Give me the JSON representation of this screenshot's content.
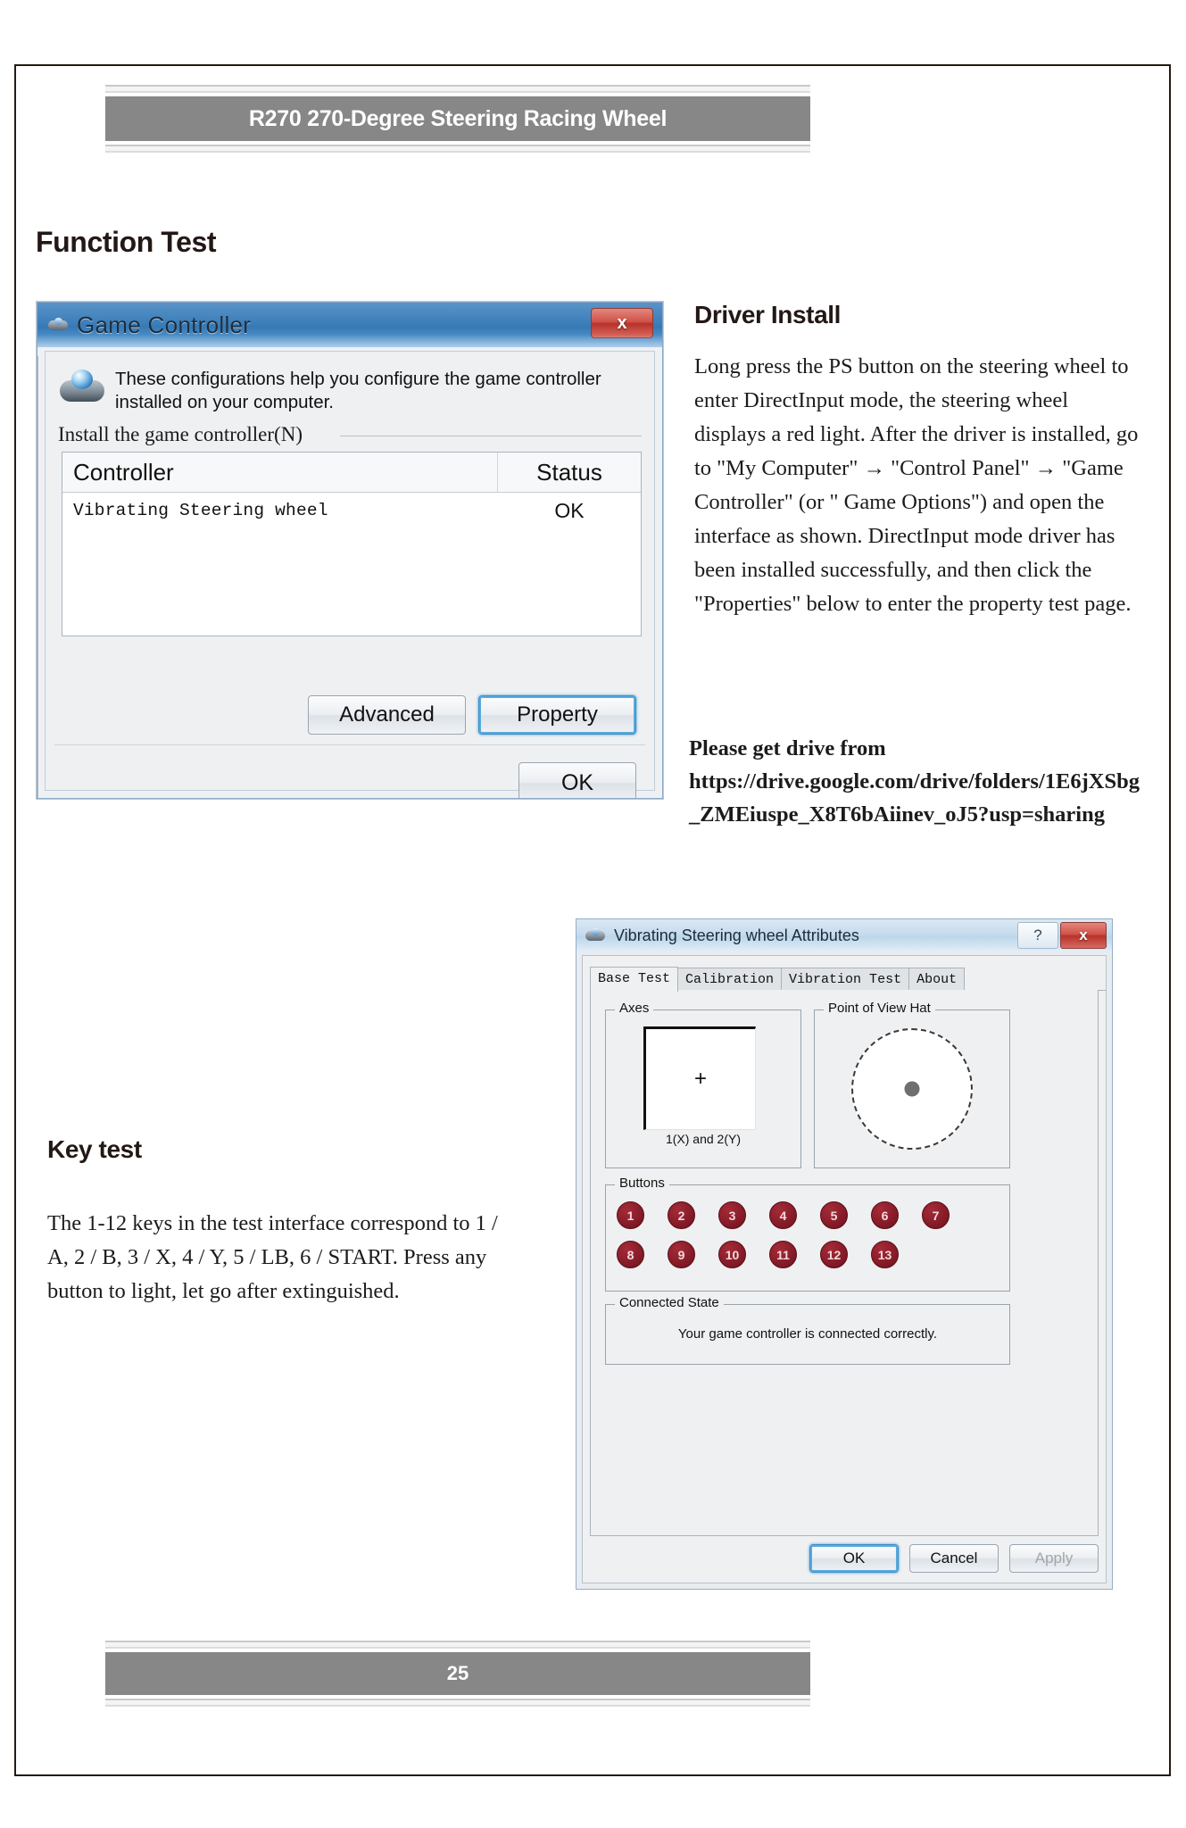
{
  "page": {
    "header_title": "R270 270-Degree Steering Racing Wheel",
    "footer_page_number": "25"
  },
  "sections": {
    "function_test_heading": "Function Test",
    "driver_install_heading": "Driver Install",
    "driver_install_paragraph": "Long press the PS button on the steering wheel to enter DirectInput mode, the steering wheel displays a red light. After the driver is installed, go to \"My Computer\" → \"Control Panel\" → \"Game Controller\" (or \" Game Options\") and open the interface as shown. DirectInput mode driver has been installed successfully, and then click the \"Properties\" below to enter the property test page.",
    "driver_link_paragraph": "Please get drive from https://drive.google.com/drive/folders/1E6jXSbg_ZMEiuspe_X8T6bAiinev_oJ5?usp=sharing",
    "key_test_heading": "Key test",
    "key_test_paragraph": "The 1-12 keys in the test interface correspond to 1 / A, 2 / B, 3 / X, 4 / Y, 5 / LB, 6 / START. Press any button to light, let go after extinguished."
  },
  "game_controller_dialog": {
    "title": "Game  Controller",
    "close_label": "x",
    "info_text": "These configurations help you configure the game controller installed on your computer.",
    "group_label": "Install the game controller(N)",
    "columns": [
      "Controller",
      "Status"
    ],
    "rows": [
      {
        "controller": "Vibrating Steering wheel",
        "status": "OK"
      }
    ],
    "advanced_label": "Advanced",
    "property_label": "Property",
    "ok_label": "OK"
  },
  "attributes_dialog": {
    "title": "Vibrating Steering wheel Attributes",
    "help_label": "?",
    "close_label": "x",
    "tabs": [
      {
        "label": "Base Test",
        "active": true
      },
      {
        "label": "Calibration",
        "active": false
      },
      {
        "label": "Vibration Test",
        "active": false
      },
      {
        "label": "About",
        "active": false
      }
    ],
    "axes_group_label": "Axes",
    "axes_caption": "1(X) and 2(Y)",
    "axes_crosshair_glyph": "+",
    "pov_group_label": "Point of View Hat",
    "buttons_group_label": "Buttons",
    "button_row_1": [
      "1",
      "2",
      "3",
      "4",
      "5",
      "6",
      "7"
    ],
    "button_row_2": [
      "8",
      "9",
      "10",
      "11",
      "12",
      "13"
    ],
    "connected_group_label": "Connected State",
    "connected_text": "Your game controller is connected correctly.",
    "ok_label": "OK",
    "cancel_label": "Cancel",
    "apply_label": "Apply"
  }
}
